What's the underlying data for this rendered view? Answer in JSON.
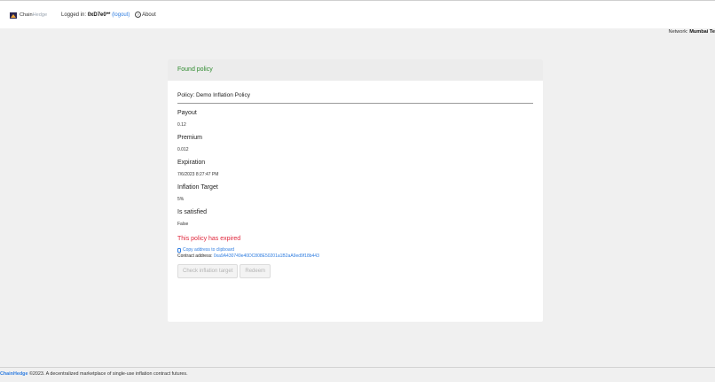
{
  "nav": {
    "brand_chain": "Chain",
    "brand_hedge": "Hedge",
    "logged_in_label": "Logged in:",
    "address": "0xD7e0**",
    "logout_label": "(logout)",
    "about_label": "About",
    "about_icon": "question-circle-icon"
  },
  "network": {
    "label": "Network:",
    "value": "Mumbai Te"
  },
  "card": {
    "header": "Found policy",
    "policy_name": "Policy: Demo Inflation Policy",
    "fields": [
      {
        "label": "Payout",
        "value": "0.12"
      },
      {
        "label": "Premium",
        "value": "0.012"
      },
      {
        "label": "Expiration",
        "value": "7/6/2023 8:27:47 PM"
      },
      {
        "label": "Inflation Target",
        "value": "5%"
      },
      {
        "label": "Is satisfied",
        "value": "False"
      }
    ],
    "expired_notice": "This policy has expired",
    "copy_label": "Copy address to clipboard",
    "contract_label": "Contract address:",
    "contract_address": "0xa9A430749e40DC808E50201a1B2aA9ed9f18b443",
    "check_button": "Check inflation target",
    "redeem_button": "Redeem"
  },
  "footer": {
    "brand": "ChainHedge",
    "text": " ©2023. A decentralized marketplace of single-use inflation contract futures."
  },
  "colors": {
    "success": "#2e8b2e",
    "danger": "#e0263b",
    "link": "#2f7de0",
    "brand_dark": "#2a2550"
  }
}
